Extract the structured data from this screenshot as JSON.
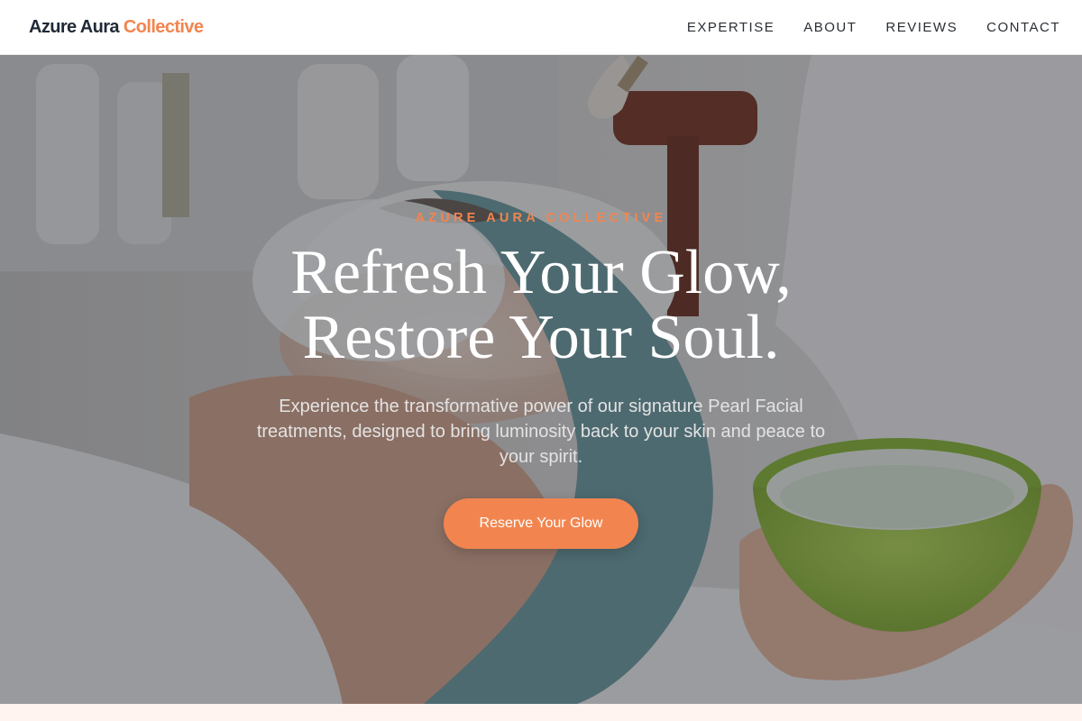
{
  "header": {
    "logo_part1": "Azure Aura",
    "logo_part2": "Collective",
    "nav": [
      {
        "label": "EXPERTISE"
      },
      {
        "label": "ABOUT"
      },
      {
        "label": "REVIEWS"
      },
      {
        "label": "CONTACT"
      }
    ]
  },
  "hero": {
    "kicker": "AZURE AURA COLLECTIVE",
    "headline_line1": "Refresh Your Glow,",
    "headline_line2": "Restore Your Soul.",
    "subtitle": "Experience the transformative power of our signature Pearl Facial treatments, designed to bring luminosity back to your skin and peace to your spirit.",
    "cta_label": "Reserve Your Glow",
    "background_image": "facial-spa-treatment-photo"
  },
  "colors": {
    "accent": "#f2854f",
    "logo_dark": "#1f2a36",
    "hero_overlay": "#20242c"
  }
}
